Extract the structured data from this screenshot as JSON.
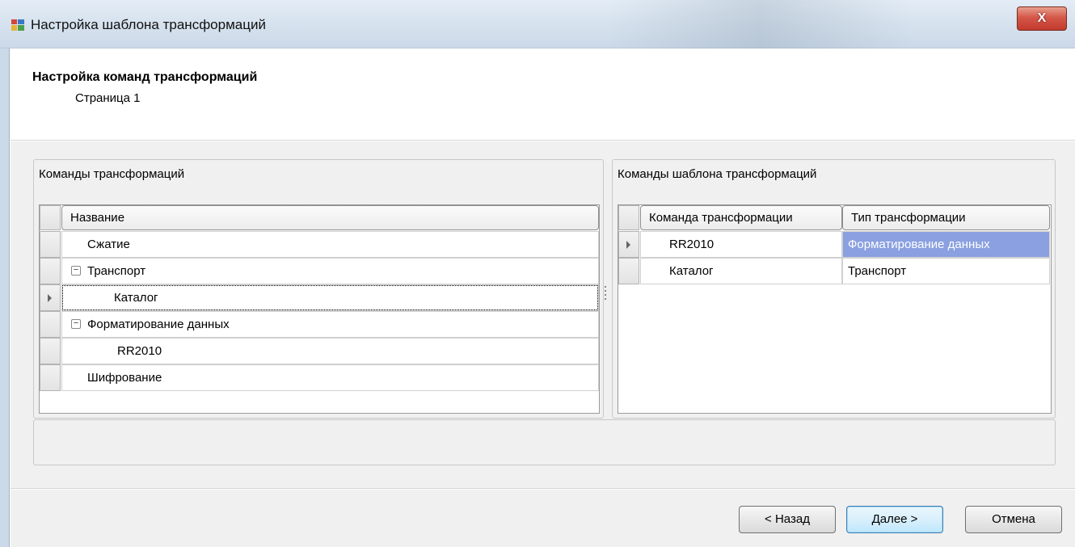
{
  "window": {
    "title": "Настройка шаблона трансформаций",
    "close_label": "X"
  },
  "header": {
    "title": "Настройка команд трансформаций",
    "subtitle": "Страница 1"
  },
  "left_panel": {
    "title": "Команды трансформаций",
    "column_header": "Название",
    "rows": [
      {
        "label": "Сжатие"
      },
      {
        "label": "Транспорт"
      },
      {
        "label": "Каталог"
      },
      {
        "label": "Форматирование данных"
      },
      {
        "label": "RR2010"
      },
      {
        "label": "Шифрование"
      }
    ]
  },
  "right_panel": {
    "title": "Команды шаблона трансформаций",
    "columns": [
      "Команда трансформации",
      "Тип трансформации"
    ],
    "rows": [
      {
        "command": "RR2010",
        "type": "Форматирование данных"
      },
      {
        "command": "Каталог",
        "type": "Транспорт"
      }
    ]
  },
  "buttons": {
    "back": "< Назад",
    "next": "Далее >",
    "cancel": "Отмена"
  },
  "colors": {
    "selection": "#8aa0e0",
    "close": "#c23a2c"
  }
}
